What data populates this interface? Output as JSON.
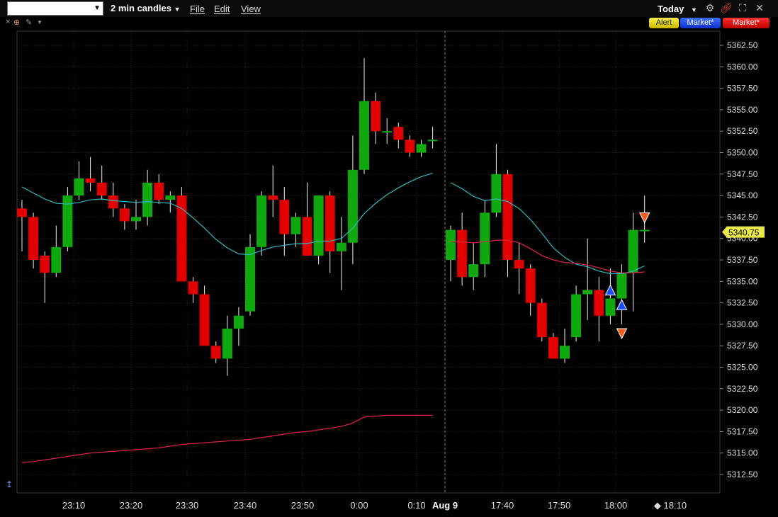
{
  "toolbar": {
    "symbol_value": "",
    "timeframe": "2 min candles",
    "menus": [
      "File",
      "Edit",
      "View"
    ],
    "range": "Today",
    "alert_label": "Alert",
    "buy_label": "Market*",
    "sell_label": "Market*"
  },
  "chart_data": {
    "type": "candlestick",
    "y_ticks": [
      5362.5,
      5360.0,
      5357.5,
      5355.0,
      5352.5,
      5350.0,
      5347.5,
      5345.0,
      5342.5,
      5340.0,
      5337.5,
      5335.0,
      5332.5,
      5330.0,
      5327.5,
      5325.0,
      5322.5,
      5320.0,
      5317.5,
      5315.0,
      5312.5
    ],
    "x_labels": [
      "23:10",
      "23:20",
      "23:30",
      "23:40",
      "23:50",
      "0:00",
      "0:10",
      "Aug 9",
      "17:40",
      "17:50",
      "18:00",
      "18:10"
    ],
    "last_price": "5340.75",
    "ylim": [
      5310.5,
      5364.0
    ],
    "grid": true,
    "colors": {
      "up": "#0fa80f",
      "down": "#e00000",
      "ma_fast": "#30b8c0",
      "ma_slow": "#e0204a",
      "background": "#000000",
      "grid": "#2a2a2a",
      "last_price_bg": "#e8e84a"
    },
    "session1": {
      "start_time": "23:04",
      "candles": [
        [
          5343.5,
          5344.5,
          5338.5,
          5342.5
        ],
        [
          5342.5,
          5343.0,
          5336.5,
          5337.5
        ],
        [
          5338.0,
          5338.5,
          5332.5,
          5336.0
        ],
        [
          5336.0,
          5341.5,
          5335.5,
          5339.0
        ],
        [
          5339.0,
          5346.0,
          5338.5,
          5345.0
        ],
        [
          5345.0,
          5349.0,
          5344.5,
          5347.0
        ],
        [
          5347.0,
          5349.5,
          5345.5,
          5346.5
        ],
        [
          5346.5,
          5348.5,
          5344.5,
          5345.0
        ],
        [
          5345.0,
          5346.5,
          5342.5,
          5343.5
        ],
        [
          5343.5,
          5344.0,
          5341.0,
          5342.0
        ],
        [
          5342.0,
          5344.5,
          5341.0,
          5342.5
        ],
        [
          5342.5,
          5348.0,
          5341.5,
          5346.5
        ],
        [
          5346.5,
          5347.5,
          5344.0,
          5344.5
        ],
        [
          5344.5,
          5345.5,
          5343.0,
          5345.0
        ],
        [
          5345.0,
          5346.0,
          5339.0,
          5335.0
        ],
        [
          5335.0,
          5335.5,
          5332.5,
          5333.5
        ],
        [
          5333.5,
          5334.5,
          5329.0,
          5327.5
        ],
        [
          5327.5,
          5328.0,
          5325.5,
          5326.0
        ],
        [
          5326.0,
          5331.0,
          5324.0,
          5329.5
        ],
        [
          5329.5,
          5332.0,
          5327.5,
          5331.0
        ],
        [
          5331.5,
          5340.5,
          5331.0,
          5339.0
        ],
        [
          5339.0,
          5345.5,
          5338.0,
          5345.0
        ],
        [
          5345.0,
          5348.5,
          5342.5,
          5344.5
        ],
        [
          5344.5,
          5346.0,
          5338.0,
          5340.5
        ],
        [
          5340.5,
          5343.0,
          5339.0,
          5342.5
        ],
        [
          5342.5,
          5346.5,
          5338.5,
          5338.0
        ],
        [
          5338.0,
          5344.0,
          5337.0,
          5345.0
        ],
        [
          5345.0,
          5345.5,
          5336.0,
          5338.5
        ],
        [
          5338.5,
          5342.5,
          5334.0,
          5339.5
        ],
        [
          5339.5,
          5352.0,
          5337.0,
          5348.0
        ],
        [
          5348.0,
          5361.0,
          5347.5,
          5356.0
        ],
        [
          5356.0,
          5357.0,
          5351.0,
          5352.5
        ],
        [
          5352.5,
          5354.0,
          5351.0,
          5352.5
        ],
        [
          5353.0,
          5353.5,
          5350.5,
          5351.5
        ],
        [
          5351.5,
          5352.0,
          5349.5,
          5350.0
        ],
        [
          5350.0,
          5351.5,
          5349.5,
          5351.0
        ],
        [
          5351.5,
          5353.0,
          5350.5,
          5351.5
        ]
      ],
      "ma_fast": [
        5346.0,
        5345.3,
        5344.6,
        5344.1,
        5344.0,
        5344.2,
        5344.5,
        5344.6,
        5344.4,
        5344.3,
        5344.2,
        5344.3,
        5344.2,
        5344.1,
        5343.5,
        5342.4,
        5341.2,
        5339.9,
        5338.9,
        5338.2,
        5338.1,
        5338.6,
        5339.0,
        5339.2,
        5339.4,
        5339.4,
        5339.7,
        5339.7,
        5340.0,
        5341.2,
        5342.9,
        5344.1,
        5345.1,
        5345.9,
        5346.6,
        5347.2,
        5347.6
      ],
      "ma_slow": [
        5313.9,
        5314.0,
        5314.2,
        5314.4,
        5314.6,
        5314.8,
        5315.0,
        5315.1,
        5315.2,
        5315.3,
        5315.4,
        5315.5,
        5315.6,
        5315.8,
        5316.0,
        5316.1,
        5316.2,
        5316.3,
        5316.4,
        5316.5,
        5316.6,
        5316.8,
        5317.0,
        5317.2,
        5317.4,
        5317.5,
        5317.7,
        5317.9,
        5318.1,
        5318.5,
        5319.2,
        5319.3,
        5319.4,
        5319.4,
        5319.4,
        5319.4,
        5319.4
      ]
    },
    "session2": {
      "start_time": "17:28",
      "candles": [
        [
          5337.5,
          5341.5,
          5335.0,
          5341.0
        ],
        [
          5341.0,
          5343.0,
          5334.5,
          5335.5
        ],
        [
          5335.5,
          5339.5,
          5334.0,
          5337.0
        ],
        [
          5337.0,
          5344.5,
          5335.5,
          5343.0
        ],
        [
          5343.0,
          5351.0,
          5342.5,
          5347.5
        ],
        [
          5347.5,
          5348.0,
          5335.5,
          5337.5
        ],
        [
          5337.5,
          5339.5,
          5333.5,
          5336.5
        ],
        [
          5336.5,
          5337.0,
          5331.0,
          5332.5
        ],
        [
          5332.5,
          5333.0,
          5328.0,
          5328.5
        ],
        [
          5328.5,
          5329.0,
          5326.5,
          5326.0
        ],
        [
          5326.0,
          5329.5,
          5325.5,
          5327.5
        ],
        [
          5328.5,
          5334.5,
          5328.0,
          5333.5
        ],
        [
          5333.5,
          5340.0,
          5330.5,
          5334.0
        ],
        [
          5334.0,
          5335.5,
          5328.0,
          5331.0
        ],
        [
          5331.0,
          5336.5,
          5330.0,
          5333.0
        ],
        [
          5333.0,
          5337.0,
          5330.0,
          5336.0
        ],
        [
          5336.0,
          5343.0,
          5331.5,
          5341.0
        ],
        [
          5341.0,
          5345.0,
          5339.5,
          5341.0
        ]
      ],
      "ma_fast": [
        5346.5,
        5345.8,
        5344.9,
        5344.4,
        5344.6,
        5344.3,
        5343.5,
        5342.2,
        5340.6,
        5338.9,
        5337.8,
        5337.0,
        5336.7,
        5336.2,
        5335.9,
        5335.9,
        5336.2,
        5336.8
      ],
      "ma_slow": [
        5339.6,
        5339.6,
        5339.5,
        5339.6,
        5339.8,
        5339.8,
        5339.5,
        5338.8,
        5338.0,
        5337.5,
        5337.2,
        5337.1,
        5336.9,
        5336.6,
        5336.2,
        5336.0,
        5336.0,
        5336.1
      ]
    },
    "markers": [
      {
        "type": "buy",
        "candle": 14,
        "price": 5333.9
      },
      {
        "type": "buy",
        "candle": 15,
        "price": 5332.2
      },
      {
        "type": "sell",
        "candle": 15,
        "price": 5329.0
      },
      {
        "type": "sell",
        "candle": 17,
        "price": 5342.5
      }
    ]
  }
}
